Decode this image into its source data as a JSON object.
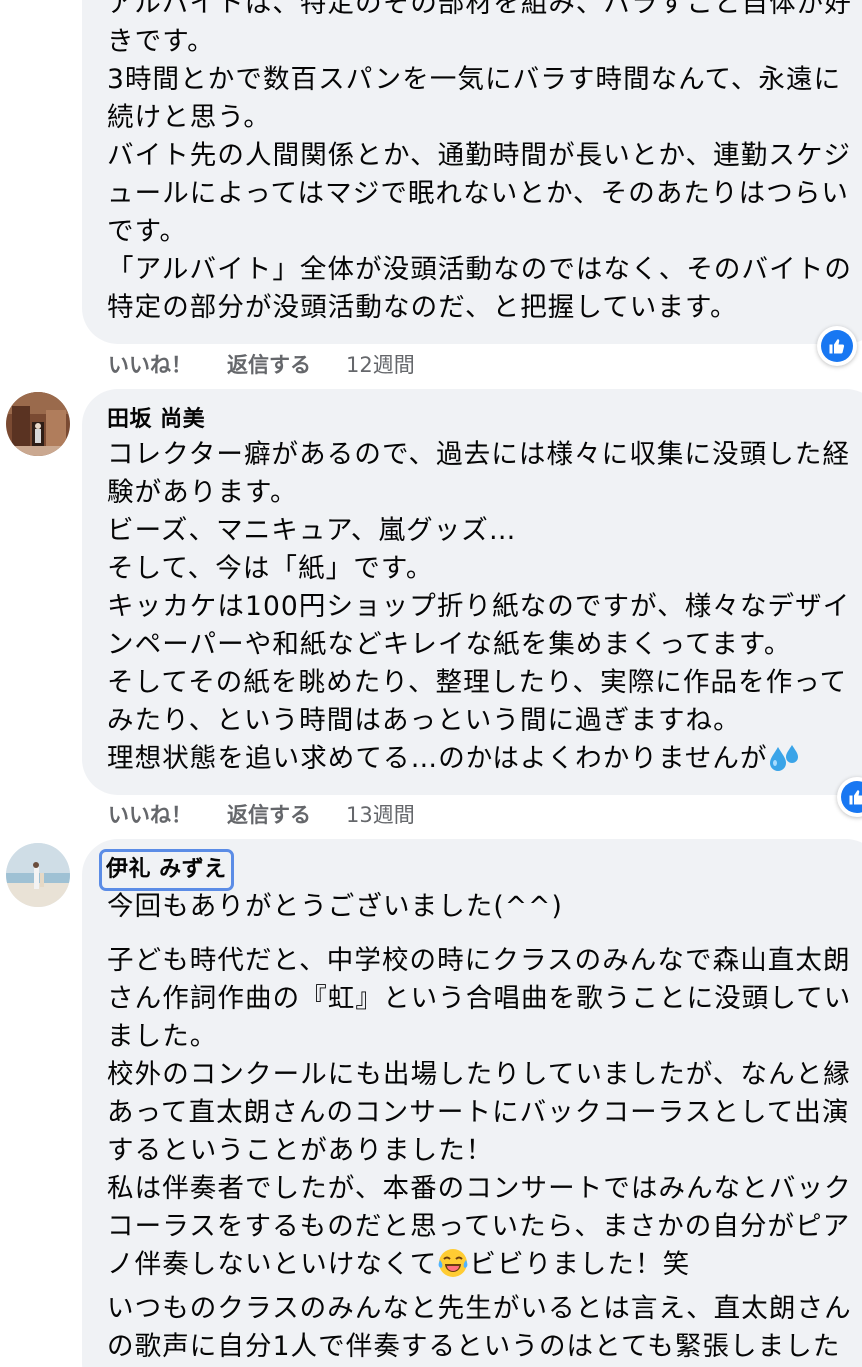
{
  "comments": [
    {
      "author": "",
      "lines": [
        "アルバイトは、特定のその部材を組み、バラすこと自体が好",
        "きです。",
        "3時間とかで数百スパンを一気にバラす時間なんて、永遠に",
        "続けと思う。",
        "バイト先の人間関係とか、通勤時間が長いとか、連勤スケジ",
        "ュールによってはマジで眠れないとか、そのあたりはつらい",
        "です。",
        "「アルバイト」全体が没頭活動なのではなく、そのバイトの",
        "特定の部分が没頭活動なのだ、と把握しています。"
      ],
      "actions": {
        "like": "いいね！",
        "reply": "返信する",
        "time": "12週間"
      },
      "reaction_icon": "like-icon"
    },
    {
      "author": "田坂 尚美",
      "lines": [
        "コレクター癖があるので、過去には様々に収集に没頭した経",
        "験があります。",
        "ビーズ、マニキュア、嵐グッズ…",
        "そして、今は「紙」です。",
        "キッカケは100円ショップ折り紙なのですが、様々なデザイ",
        "ンペーパーや和紙などキレイな紙を集めまくってます。",
        "そしてその紙を眺めたり、整理したり、実際に作品を作って",
        "みたり、という時間はあっという間に過ぎますね。",
        "理想状態を追い求めてる…のかはよくわかりませんが"
      ],
      "trailing_emoji": "sweat-droplets-icon",
      "actions": {
        "like": "いいね！",
        "reply": "返信する",
        "time": "13週間"
      },
      "reaction_icon": "like-icon"
    },
    {
      "author": "伊礼 みずえ",
      "first_line": "今回もありがとうございました(^^)",
      "lines": [
        "子ども時代だと、中学校の時にクラスのみんなで森山直太朗",
        "さん作詞作曲の『虹』という合唱曲を歌うことに没頭してい",
        "ました。",
        "校外のコンクールにも出場したりしていましたが、なんと縁",
        "あって直太朗さんのコンサートにバックコーラスとして出演",
        "するということがありました！",
        "私は伴奏者でしたが、本番のコンサートではみんなとバック",
        "コーラスをするものだと思っていたら、まさかの自分がピア",
        "ノ伴奏しないといけなくて",
        "いつものクラスのみんなと先生がいるとは言え、直太朗さん",
        "の歌声に自分1人で伴奏するというのはとても緊張しました"
      ],
      "inline_emoji_after": "ビビりました！笑",
      "inline_emoji": "tears-of-joy-icon"
    }
  ],
  "colors": {
    "bubble": "#f0f2f5",
    "secondary_text": "#65676b",
    "like_blue": "#1877f2",
    "focus_outline": "#5b8ce6"
  }
}
